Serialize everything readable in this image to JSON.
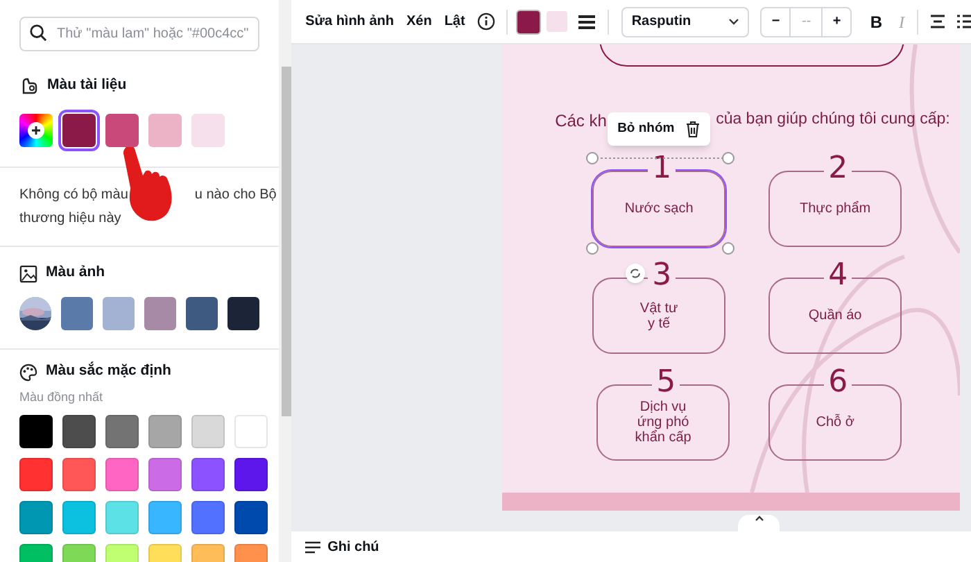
{
  "search": {
    "placeholder": "Thử \"màu lam\" hoặc \"#00c4cc\""
  },
  "document_colors": {
    "title": "Màu tài liệu",
    "swatches": [
      {
        "color": "#8b1a48",
        "selected": true
      },
      {
        "color": "#c94a7a",
        "selected": false
      },
      {
        "color": "#ecb3c7",
        "selected": false
      },
      {
        "color": "#f6e0ec",
        "selected": false
      }
    ]
  },
  "brand_note": {
    "line_1_start": "Không có bộ màu",
    "line_1_end": "u nào cho Bộ",
    "line_2": "thương hiệu này"
  },
  "photo_colors": {
    "title": "Màu ảnh",
    "swatches": [
      {
        "kind": "picture"
      },
      {
        "kind": "color",
        "color": "#5a7aaa"
      },
      {
        "kind": "color",
        "color": "#a3b1d2"
      },
      {
        "kind": "color",
        "color": "#a78aa5"
      },
      {
        "kind": "color",
        "color": "#3e5a80"
      },
      {
        "kind": "color",
        "color": "#1c2538"
      }
    ]
  },
  "default_colors": {
    "title": "Màu sắc mặc định",
    "subtitle": "Màu đồng nhất",
    "swatches": [
      {
        "color": "#000000"
      },
      {
        "color": "#4d4d4d"
      },
      {
        "color": "#737373"
      },
      {
        "color": "#a6a6a6"
      },
      {
        "color": "#d9d9d9"
      },
      {
        "color": "#ffffff"
      },
      {
        "color": "#ff3131"
      },
      {
        "color": "#ff5757"
      },
      {
        "color": "#ff66c4"
      },
      {
        "color": "#cb6ce6"
      },
      {
        "color": "#8c52ff"
      },
      {
        "color": "#5e17eb"
      },
      {
        "color": "#0097b2"
      },
      {
        "color": "#0cc0df"
      },
      {
        "color": "#5ce1e6"
      },
      {
        "color": "#38b6ff"
      },
      {
        "color": "#5271ff"
      },
      {
        "color": "#004aad"
      },
      {
        "color": "#00bf63"
      },
      {
        "color": "#7ed957"
      },
      {
        "color": "#c1ff72"
      },
      {
        "color": "#ffde59"
      },
      {
        "color": "#ffbd59"
      },
      {
        "color": "#ff914d"
      }
    ]
  },
  "toolbar": {
    "edit_image": "Sửa hình ảnh",
    "crop": "Xén",
    "flip": "Lật",
    "color_swatches": [
      {
        "color": "#8b1a48"
      },
      {
        "color": "#f6e0ec"
      }
    ],
    "font": "Rasputin",
    "decrease": "−",
    "size": "--",
    "increase": "+",
    "bold": "B",
    "italic": "I"
  },
  "canvas": {
    "heading_start": "Các kh",
    "heading_end": "của bạn giúp chúng tôi cung cấp:",
    "popup": {
      "label": "Bỏ nhóm"
    },
    "cards": [
      {
        "number": "1",
        "label": "Nước sạch",
        "selected": true
      },
      {
        "number": "2",
        "label": "Thực phẩm",
        "selected": false
      },
      {
        "number": "3",
        "label": "Vật tư\ny tế",
        "selected": false
      },
      {
        "number": "4",
        "label": "Quần áo",
        "selected": false
      },
      {
        "number": "5",
        "label": "Dịch vụ\nứng phó\nkhẩn cấp",
        "selected": false
      },
      {
        "number": "6",
        "label": "Chỗ ở",
        "selected": false
      }
    ]
  },
  "footer": {
    "notes": "Ghi chú"
  }
}
